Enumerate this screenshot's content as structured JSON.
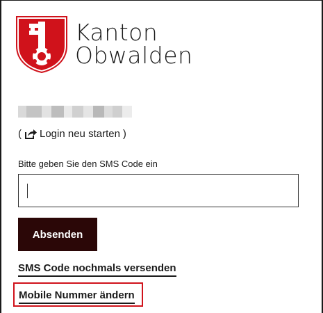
{
  "brand": {
    "line1": "Kanton",
    "line2": "Obwalden",
    "logo_icon": "obwalden-coat-of-arms-icon",
    "logo_color": "#d0121b"
  },
  "login": {
    "paren_open": "(",
    "paren_close": ")",
    "restart_label": "Login neu starten",
    "restart_icon": "share-export-icon"
  },
  "sms": {
    "prompt_label": "Bitte geben Sie den SMS Code ein",
    "code_value": "",
    "submit_label": "Absenden",
    "resend_label": "SMS Code nochmals versenden",
    "change_number_label": "Mobile Nummer ändern"
  },
  "colors": {
    "button_bg": "#2b0707",
    "highlight_border": "#d0121b"
  }
}
